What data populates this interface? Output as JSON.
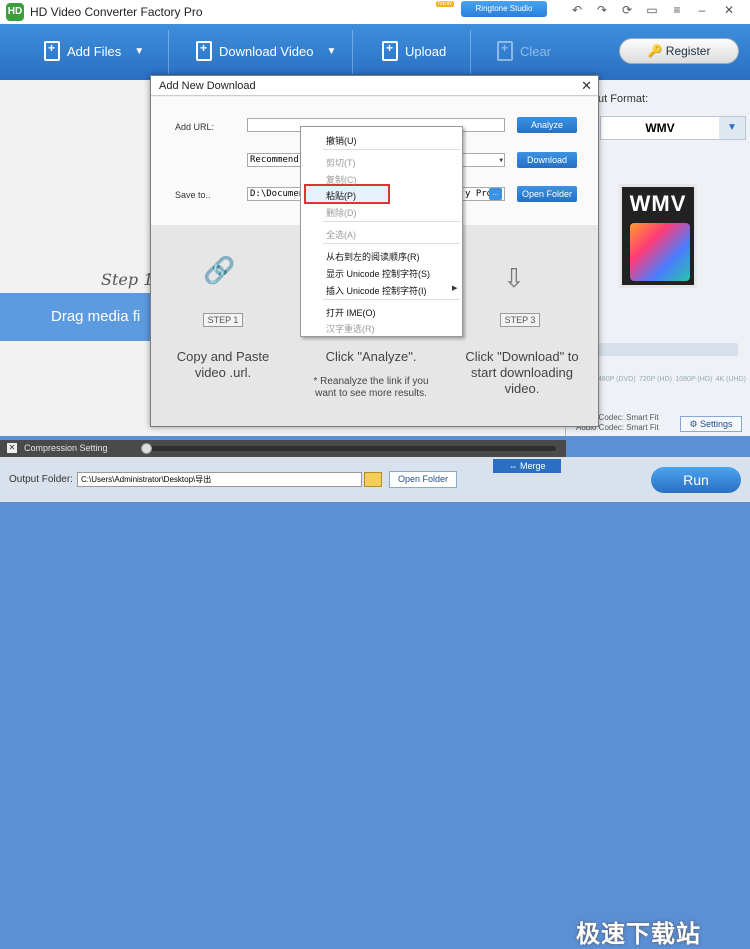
{
  "app": {
    "title": "HD Video Converter Factory Pro",
    "logo": "HD",
    "ringtone_studio": "Ringtone Studio",
    "new_badge": "NEW"
  },
  "toolbar": {
    "add_files": "Add Files",
    "download_video": "Download Video",
    "upload": "Upload",
    "clear": "Clear",
    "register": "Register"
  },
  "main": {
    "drag_text": "Drag media fi",
    "step_bg": "Step 1:"
  },
  "right": {
    "output_format_label": "ut Format:",
    "format_value": "WMV",
    "wmv_icon_text": "WMV",
    "resolutions": [
      "480P (DVD)",
      "720P (HD)",
      "1080P (HD)",
      "4K (UHD)"
    ],
    "video_codec": "Video Codec: Smart Fit",
    "audio_codec": "Audio Codec: Smart Fit",
    "settings": "Settings"
  },
  "compression": {
    "label": "Compression Setting"
  },
  "bottom": {
    "output_folder_label": "Output Folder:",
    "output_folder_value": "C:\\Users\\Administrator\\Desktop\\导出",
    "open_folder": "Open Folder",
    "merge": "Merge",
    "run": "Run",
    "watermark": "极速下载站"
  },
  "dialog": {
    "title": "Add New Download",
    "add_url_label": "Add URL:",
    "url_value": "",
    "analyze": "Analyze",
    "quality_value": "Recommend",
    "download": "Download",
    "save_to_label": "Save to..",
    "save_path_start": "D:\\Document",
    "save_path_end": "y Pro\\I",
    "dots": "...",
    "open_folder": "Open Folder",
    "steps": [
      {
        "label": "STEP 1",
        "desc": "Copy and Paste video .url."
      },
      {
        "label": "STEP 2",
        "desc": "Click \"Analyze\".",
        "note": "* Reanalyze the link if you want to see more results."
      },
      {
        "label": "STEP 3",
        "desc": "Click \"Download\" to start downloading video."
      }
    ]
  },
  "context_menu": {
    "items": [
      {
        "label": "撤销(U)",
        "enabled": true
      },
      {
        "label": "剪切(T)",
        "enabled": false
      },
      {
        "label": "复制(C)",
        "enabled": false
      },
      {
        "label": "粘贴(P)",
        "enabled": true,
        "highlighted": true
      },
      {
        "label": "删除(D)",
        "enabled": false
      },
      {
        "label": "全选(A)",
        "enabled": false
      },
      {
        "label": "从右到左的阅读顺序(R)",
        "enabled": true
      },
      {
        "label": "显示 Unicode 控制字符(S)",
        "enabled": true
      },
      {
        "label": "插入 Unicode 控制字符(I)",
        "enabled": true,
        "submenu": true
      },
      {
        "label": "打开 IME(O)",
        "enabled": true
      },
      {
        "label": "汉字重选(R)",
        "enabled": false
      }
    ]
  },
  "colors": {
    "accent": "#2a6fc2",
    "highlight_border": "#dd3333"
  }
}
